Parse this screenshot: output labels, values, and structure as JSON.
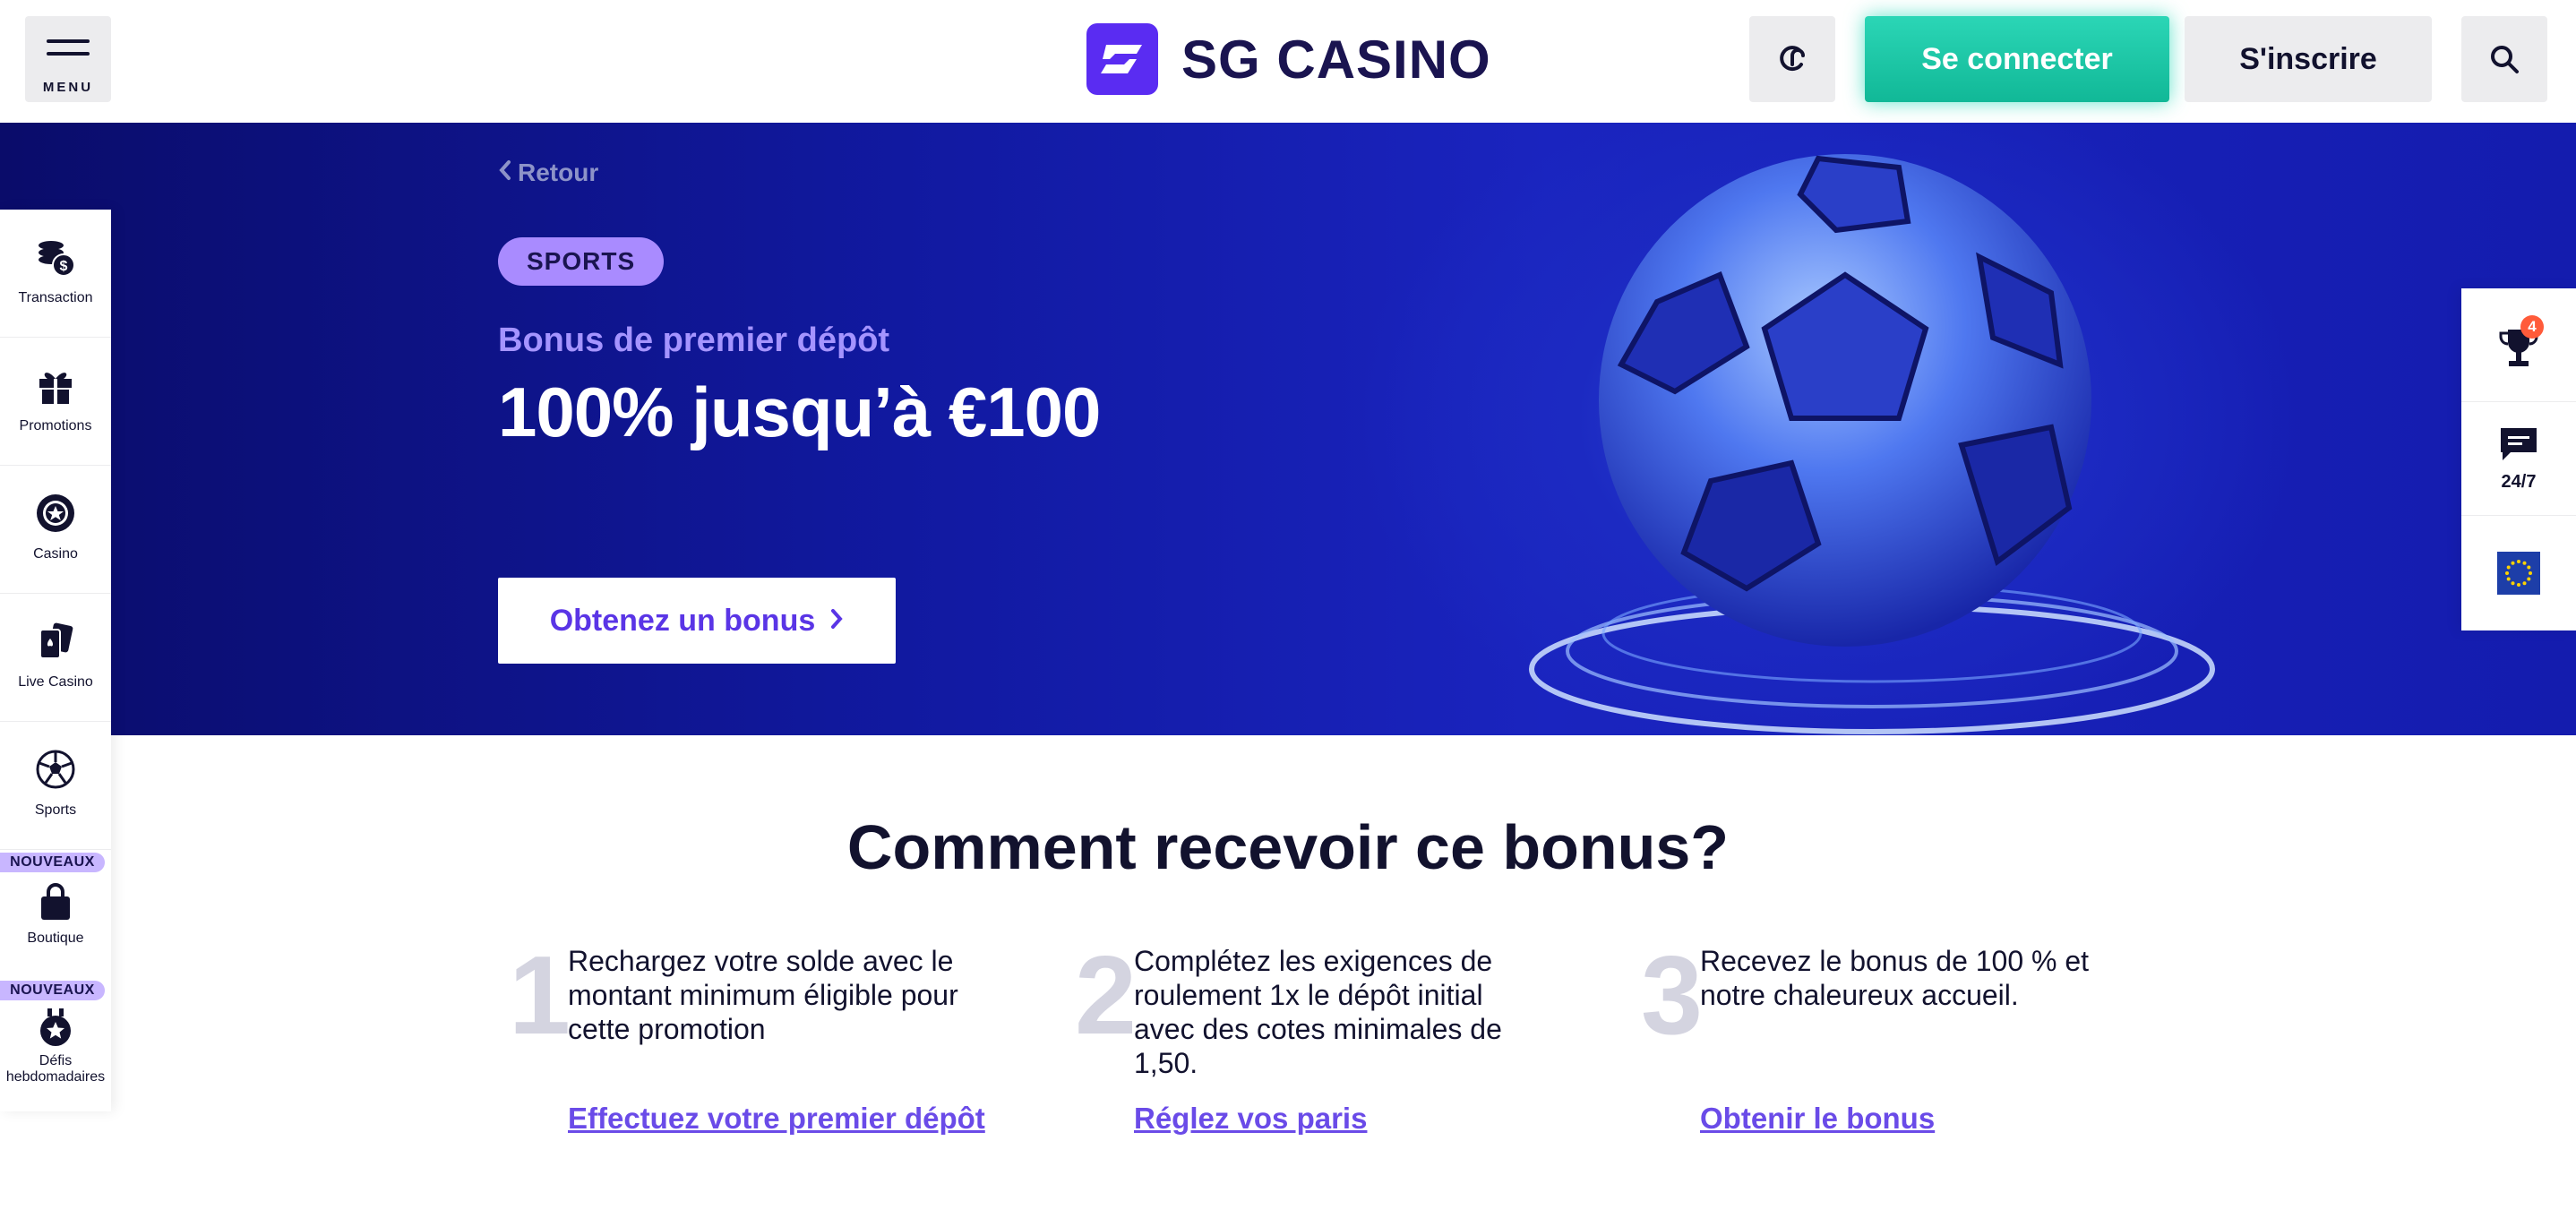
{
  "header": {
    "menu_label": "MENU",
    "logo_text": "SG CASINO",
    "login_label": "Se connecter",
    "register_label": "S'inscrire",
    "accent_login": "#1cc9a7",
    "brand_color": "#5a2cf2"
  },
  "hero": {
    "back_label": "Retour",
    "tag": "SPORTS",
    "subtitle": "Bonus de premier dépôt",
    "title": "100% jusqu’à €100",
    "cta_label": "Obtenez un bonus",
    "background_color": "#1119a0"
  },
  "sidebar": {
    "items": [
      {
        "label": "Transaction",
        "icon": "coins-dollar-icon"
      },
      {
        "label": "Promotions",
        "icon": "gift-icon"
      },
      {
        "label": "Casino",
        "icon": "casino-chip-icon"
      },
      {
        "label": "Live Casino",
        "icon": "playing-cards-icon"
      },
      {
        "label": "Sports",
        "icon": "soccer-ball-icon"
      },
      {
        "label": "Boutique",
        "icon": "shopping-bag-icon",
        "badge": "NOUVEAUX"
      },
      {
        "label": "Défis hebdomadaires",
        "icon": "medal-star-icon",
        "badge": "NOUVEAUX"
      }
    ]
  },
  "rail": {
    "trophy_count": "4",
    "support_label": "24/7",
    "language_flag": "eu-flag-icon"
  },
  "how": {
    "title": "Comment recevoir ce bonus?",
    "steps": [
      {
        "num": "1",
        "text": "Rechargez votre solde avec le montant minimum éligible pour cette promotion",
        "link": "Effectuez votre premier dépôt"
      },
      {
        "num": "2",
        "text": "Complétez les exigences de roulement 1x le dépôt initial avec des cotes minimales de 1,50.",
        "link": "Réglez vos paris"
      },
      {
        "num": "3",
        "text": "Recevez le bonus de 100 % et notre chaleureux accueil.",
        "link": "Obtenir le bonus"
      }
    ]
  }
}
